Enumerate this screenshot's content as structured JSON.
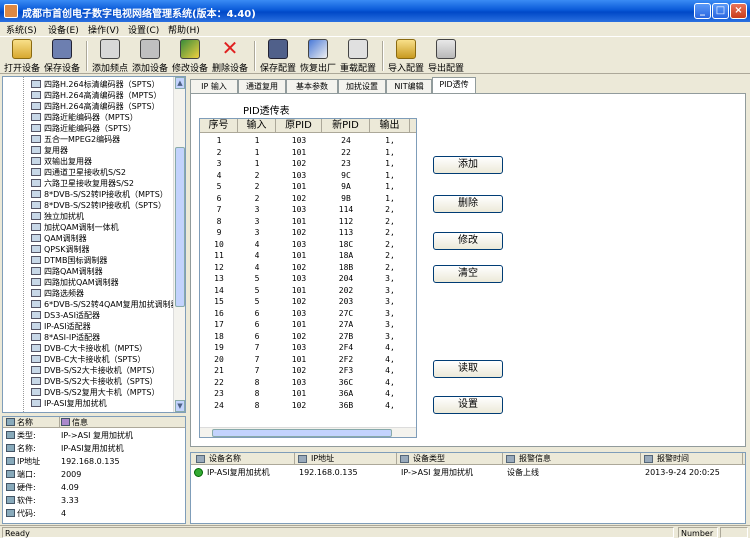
{
  "window": {
    "title": "成都市首创电子数字电视网络管理系统(版本：4.40)"
  },
  "menu": [
    "系统(S)",
    "设备(E)",
    "操作(V)",
    "设置(C)",
    "帮助(H)"
  ],
  "toolbar": [
    {
      "label": "打开设备",
      "icon": "open-device-icon"
    },
    {
      "label": "保存设备",
      "icon": "save-device-icon"
    },
    {
      "label": "添加频点",
      "icon": "add-frequency-icon"
    },
    {
      "label": "添加设备",
      "icon": "add-device-icon"
    },
    {
      "label": "修改设备",
      "icon": "edit-device-icon"
    },
    {
      "label": "删除设备",
      "icon": "delete-device-icon"
    },
    {
      "label": "保存配置",
      "icon": "save-config-icon"
    },
    {
      "label": "恢复出厂",
      "icon": "factory-reset-icon"
    },
    {
      "label": "重载配置",
      "icon": "reload-config-icon"
    },
    {
      "label": "导入配置",
      "icon": "import-config-icon"
    },
    {
      "label": "导出配置",
      "icon": "export-config-icon"
    }
  ],
  "tree": [
    "四路H.264标清编码器（SPTS）",
    "四路H.264高清编码器（MPTS）",
    "四路H.264高清编码器（SPTS）",
    "四路近能编码器（MPTS）",
    "四路近能编码器（SPTS）",
    "五合一MPEG2编码器",
    "复用器",
    "双输出复用器",
    "四通道卫星接收机S/S2",
    "六路卫星接收复用器S/S2",
    "8*DVB-S/S2转IP接收机（MPTS）",
    "8*DVB-S/S2转IP接收机（SPTS）",
    "独立加扰机",
    "加扰QAM调制一体机",
    "QAM调制器",
    "QPSK调制器",
    "DTMB国标调制器",
    "四路QAM调制器",
    "四路加扰QAM调制器",
    "四路选频器",
    "6*DVB-S/S2转4QAM复用加扰调制器",
    "DS3-ASI适配器",
    "IP-ASI适配器",
    "8*ASI-IP适配器",
    "DVB-C大卡接收机（MPTS）",
    "DVB-C大卡接收机（SPTS）",
    "DVB-S/S2大卡接收机（MPTS）",
    "DVB-S/S2大卡接收机（SPTS）",
    "DVB-S/S2复用大卡机（MPTS）",
    "IP-ASI复用加扰机"
  ],
  "info": {
    "header": {
      "name": "名称",
      "info": "信息"
    },
    "rows": [
      {
        "k": "类型:",
        "v": "IP->ASI 复用加扰机"
      },
      {
        "k": "名称:",
        "v": "IP-ASI复用加扰机"
      },
      {
        "k": "IP地址",
        "v": "192.168.0.135"
      },
      {
        "k": "端口:",
        "v": "2009"
      },
      {
        "k": "硬件:",
        "v": "4.09"
      },
      {
        "k": "软件:",
        "v": "3.33"
      },
      {
        "k": "代码:",
        "v": "4"
      }
    ]
  },
  "tabs": [
    "IP 输入",
    "通道复用",
    "基本参数",
    "加扰设置",
    "NIT编辑",
    "PID透传"
  ],
  "pid": {
    "title": "PID透传表",
    "columns": [
      "序号",
      "输入",
      "原PID",
      "新PID",
      "输出"
    ],
    "rows": [
      [
        "1",
        "1",
        "103",
        "24",
        "1,"
      ],
      [
        "2",
        "1",
        "101",
        "22",
        "1,"
      ],
      [
        "3",
        "1",
        "102",
        "23",
        "1,"
      ],
      [
        "4",
        "2",
        "103",
        "9C",
        "1,"
      ],
      [
        "5",
        "2",
        "101",
        "9A",
        "1,"
      ],
      [
        "6",
        "2",
        "102",
        "9B",
        "1,"
      ],
      [
        "7",
        "3",
        "103",
        "114",
        "2,"
      ],
      [
        "8",
        "3",
        "101",
        "112",
        "2,"
      ],
      [
        "9",
        "3",
        "102",
        "113",
        "2,"
      ],
      [
        "10",
        "4",
        "103",
        "18C",
        "2,"
      ],
      [
        "11",
        "4",
        "101",
        "18A",
        "2,"
      ],
      [
        "12",
        "4",
        "102",
        "18B",
        "2,"
      ],
      [
        "13",
        "5",
        "103",
        "204",
        "3,"
      ],
      [
        "14",
        "5",
        "101",
        "202",
        "3,"
      ],
      [
        "15",
        "5",
        "102",
        "203",
        "3,"
      ],
      [
        "16",
        "6",
        "103",
        "27C",
        "3,"
      ],
      [
        "17",
        "6",
        "101",
        "27A",
        "3,"
      ],
      [
        "18",
        "6",
        "102",
        "27B",
        "3,"
      ],
      [
        "19",
        "7",
        "103",
        "2F4",
        "4,"
      ],
      [
        "20",
        "7",
        "101",
        "2F2",
        "4,"
      ],
      [
        "21",
        "7",
        "102",
        "2F3",
        "4,"
      ],
      [
        "22",
        "8",
        "103",
        "36C",
        "4,"
      ],
      [
        "23",
        "8",
        "101",
        "36A",
        "4,"
      ],
      [
        "24",
        "8",
        "102",
        "36B",
        "4,"
      ]
    ],
    "buttons": [
      "添加",
      "删除",
      "修改",
      "清空",
      "读取",
      "设置"
    ]
  },
  "alarm": {
    "columns": [
      "设备名称",
      "IP地址",
      "设备类型",
      "报警信息",
      "报警时间"
    ],
    "rows": [
      [
        "IP-ASI复用加扰机",
        "192.168.0.135",
        "IP->ASI 复用加扰机",
        "设备上线",
        "2013-9-24 20:0:25"
      ]
    ]
  },
  "status": {
    "left": "Ready",
    "right": "Number"
  }
}
